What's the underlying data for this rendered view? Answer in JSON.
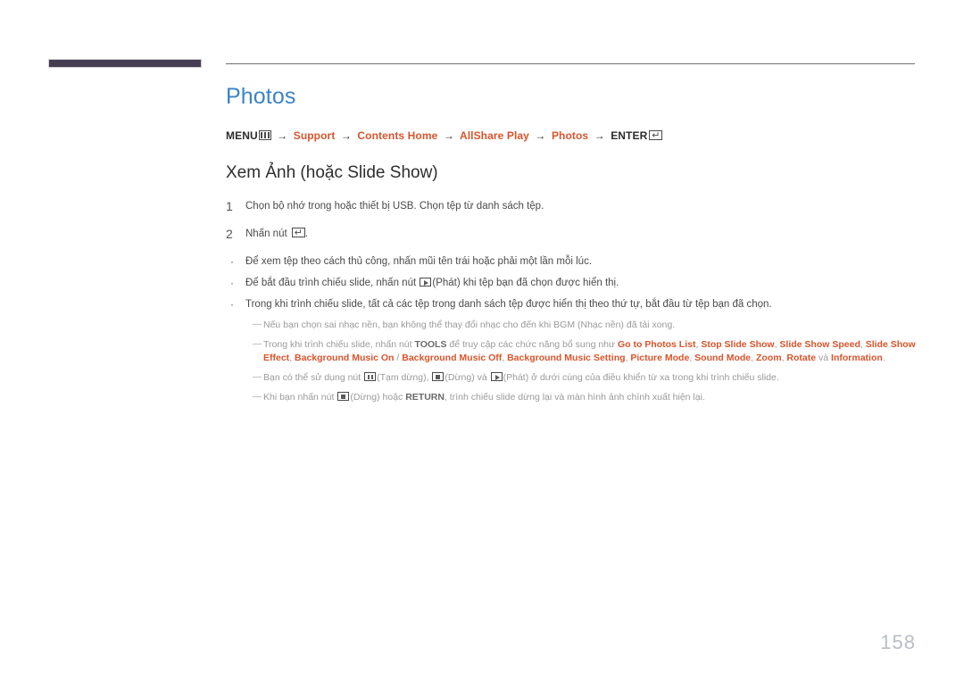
{
  "header": {
    "bar_color": "#453d52",
    "rule_color": "#6e6e6e"
  },
  "page": {
    "title": "Photos",
    "title_color": "#3c83c8",
    "accent_color": "#d9542b",
    "number": "158"
  },
  "menu_path": {
    "menu_label": "MENU",
    "menu_icon": "menu-grid-icon",
    "arrow": "→",
    "items": [
      "Support",
      "Contents Home",
      "AllShare Play",
      "Photos"
    ],
    "enter_label": "ENTER",
    "enter_icon": "enter-return-icon"
  },
  "section": {
    "heading": "Xem Ảnh (hoặc Slide Show)"
  },
  "steps": [
    {
      "number": "1",
      "text": "Chọn bộ nhớ trong hoặc thiết bị USB. Chọn tệp từ danh sách tệp."
    },
    {
      "number": "2",
      "text_before": "Nhấn nút ",
      "icon": "enter-return-icon",
      "text_after": "."
    }
  ],
  "bullets": [
    {
      "marker": "·",
      "text": "Để xem tệp theo cách thủ công, nhấn mũi tên trái hoặc phải một lần mỗi lúc."
    },
    {
      "marker": "·",
      "text_before": "Để bắt đầu trình chiếu slide, nhấn nút ",
      "icon": "play-button-icon",
      "text_after": "(Phát) khi tệp bạn đã chọn được hiển thị."
    },
    {
      "marker": "·",
      "text": "Trong khi trình chiếu slide, tất cả các tệp trong danh sách tệp được hiển thị theo thứ tự, bắt đầu từ tệp bạn đã chọn."
    }
  ],
  "notes": [
    {
      "marker": "—",
      "text": "Nếu bạn chọn sai nhạc nền, bạn không thể thay đổi nhạc cho đến khi BGM (Nhạc nền) đã tải xong."
    },
    {
      "marker": "—",
      "text_before": "Trong khi trình chiếu slide, nhấn nút ",
      "bold_1": "TOOLS",
      "text_mid": " để truy cập các chức năng bổ sung như ",
      "options": [
        "Go to Photos List",
        "Stop Slide Show",
        "Slide Show Speed",
        "Slide Show Effect",
        "Background Music On",
        "Background Music Off",
        "Background Music Setting",
        "Picture Mode",
        "Sound Mode",
        "Zoom",
        "Rotate"
      ],
      "conjunction": " và ",
      "last_option": "Information",
      "text_after": "."
    },
    {
      "marker": "—",
      "text_before": "Bạn có thể sử dụng nút ",
      "icon_1": "pause-button-icon",
      "text_1": "(Tạm dừng), ",
      "icon_2": "stop-button-icon",
      "text_2": "(Dừng) và ",
      "icon_3": "play-button-icon",
      "text_3": "(Phát) ở dưới cùng của điều khiển từ xa trong khi trình chiếu slide."
    },
    {
      "marker": "—",
      "text_before": "Khi bạn nhấn nút ",
      "icon_1": "stop-button-icon",
      "text_1": "(Dừng) hoặc ",
      "bold_1": "RETURN",
      "text_2": ", trình chiếu slide dừng lại và màn hình ảnh chính xuất hiện lại."
    }
  ]
}
